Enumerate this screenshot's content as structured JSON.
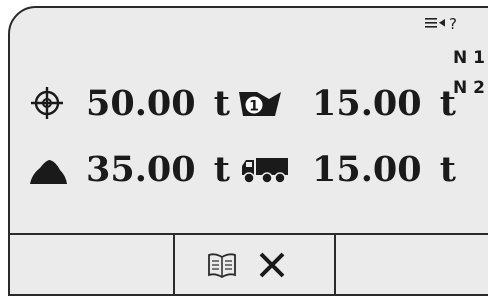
{
  "header": {
    "menu_icon": "menu-list-arrow-icon",
    "help_label": "?"
  },
  "side_labels": {
    "n1": "N 1",
    "n2": "N 2"
  },
  "readouts": {
    "total": {
      "icon": "crosshair-icon",
      "value": "50.00",
      "unit": "t"
    },
    "load1": {
      "icon": "bucket-1-icon",
      "value": "15.00",
      "unit": "t"
    },
    "pile": {
      "icon": "pile-icon",
      "value": "35.00",
      "unit": "t"
    },
    "truck": {
      "icon": "truck-icon",
      "value": "15.00",
      "unit": "t"
    }
  },
  "softkeys": {
    "book_icon": "book-icon",
    "close_icon": "close-icon"
  }
}
